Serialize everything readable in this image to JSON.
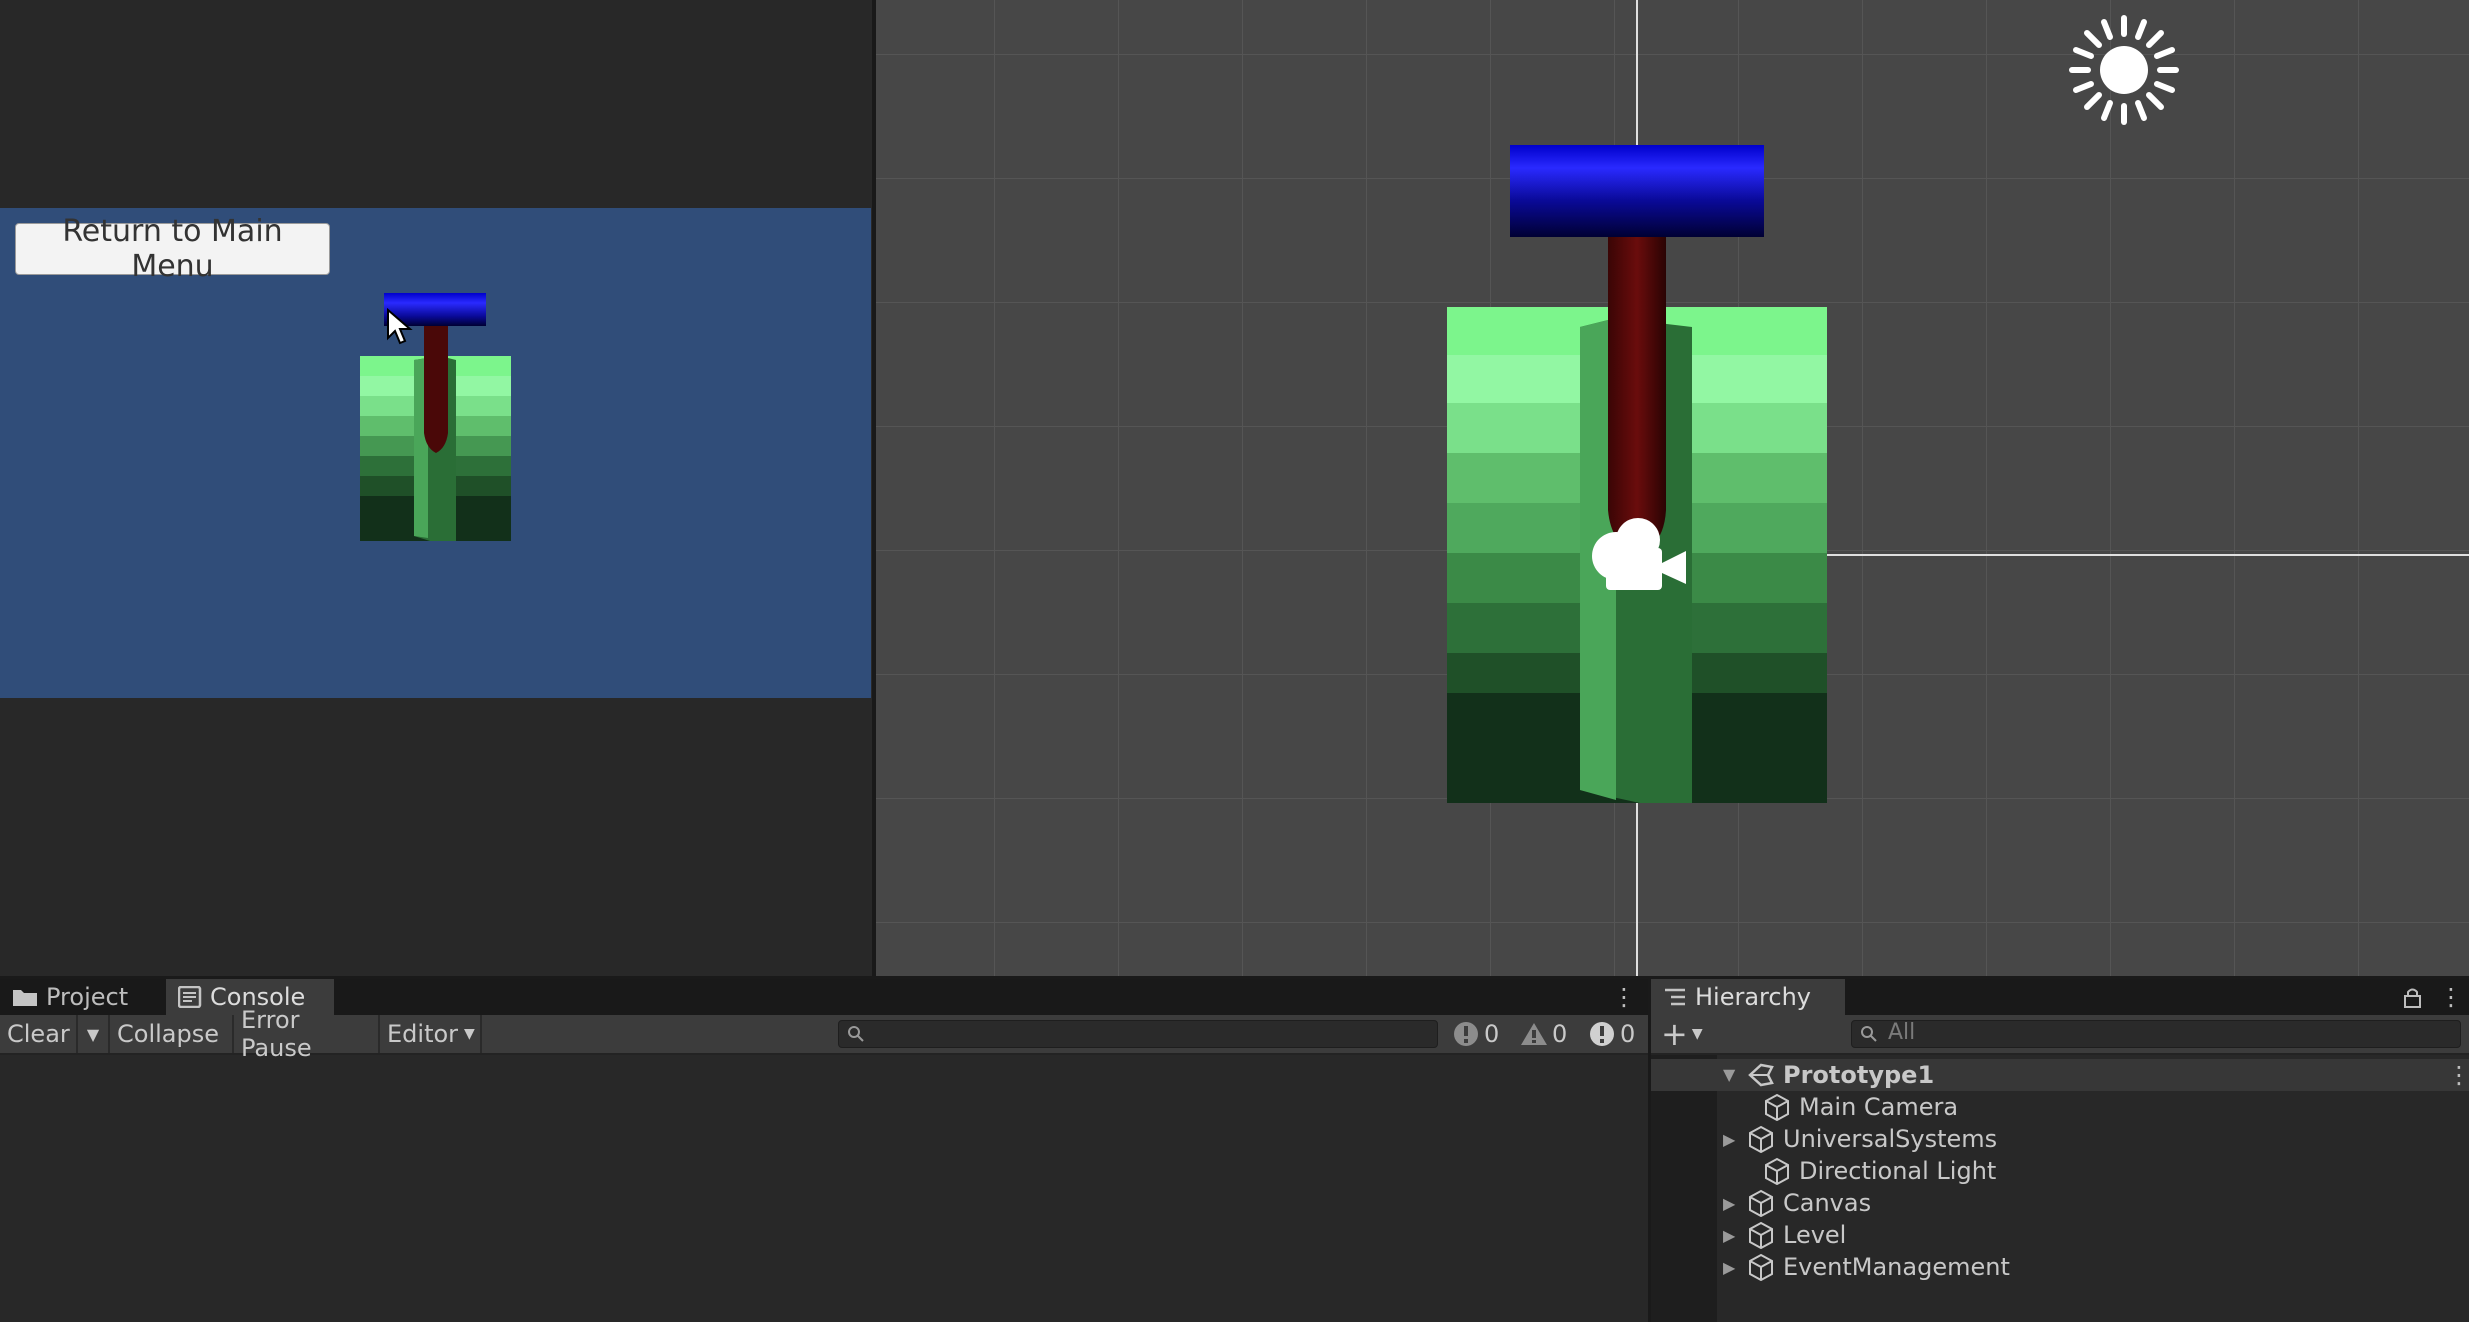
{
  "game_view": {
    "button_label": "Return to Main Menu"
  },
  "console": {
    "tabs": [
      {
        "label": "Project",
        "icon": "folder-icon"
      },
      {
        "label": "Console",
        "icon": "console-icon"
      }
    ],
    "toolbar": {
      "clear": "Clear",
      "collapse": "Collapse",
      "error_pause": "Error Pause",
      "editor": "Editor"
    },
    "counts": {
      "log": "0",
      "warning": "0",
      "error": "0"
    }
  },
  "hierarchy": {
    "tab_label": "Hierarchy",
    "search_placeholder": "All",
    "scene_name": "Prototype1",
    "items": [
      {
        "label": "Main Camera",
        "expandable": false
      },
      {
        "label": "UniversalSystems",
        "expandable": true
      },
      {
        "label": "Directional Light",
        "expandable": false
      },
      {
        "label": "Canvas",
        "expandable": true
      },
      {
        "label": "Level",
        "expandable": true
      },
      {
        "label": "EventManagement",
        "expandable": true
      }
    ]
  },
  "colors": {
    "game_background": "#304d79",
    "scene_background": "#474747",
    "hammer_head": "#1010ee",
    "handle": "#5a0a0a",
    "grass_light": "#7cf58c",
    "grass_dark": "#12301a"
  }
}
